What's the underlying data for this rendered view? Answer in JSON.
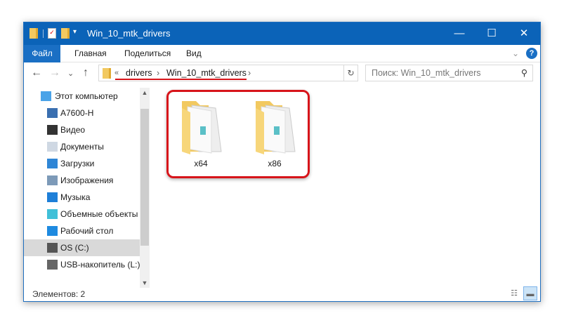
{
  "window": {
    "title": "Win_10_mtk_drivers",
    "minimize": "—",
    "maximize": "☐",
    "close": "✕"
  },
  "ribbon": {
    "tabs": [
      "Файл",
      "Главная",
      "Поделиться",
      "Вид"
    ],
    "expand": "⌄",
    "help": "?"
  },
  "nav": {
    "back": "←",
    "forward": "→",
    "recent": "⌄",
    "up": "↑"
  },
  "address": {
    "overflow": "«",
    "crumbs": [
      "drivers",
      "Win_10_mtk_drivers"
    ],
    "sep": "›",
    "refresh": "↻"
  },
  "search": {
    "placeholder": "Поиск: Win_10_mtk_drivers",
    "icon": "⚲"
  },
  "sidebar": {
    "items": [
      {
        "label": "Этот компьютер",
        "icon": "computer-icon"
      },
      {
        "label": "A7600-H",
        "icon": "phone-icon"
      },
      {
        "label": "Видео",
        "icon": "video-icon"
      },
      {
        "label": "Документы",
        "icon": "documents-icon"
      },
      {
        "label": "Загрузки",
        "icon": "downloads-icon"
      },
      {
        "label": "Изображения",
        "icon": "pictures-icon"
      },
      {
        "label": "Музыка",
        "icon": "music-icon"
      },
      {
        "label": "Объемные объекты",
        "icon": "3d-objects-icon"
      },
      {
        "label": "Рабочий стол",
        "icon": "desktop-icon"
      },
      {
        "label": "OS (C:)",
        "icon": "drive-icon",
        "selected": true
      },
      {
        "label": "USB-накопитель (L:)",
        "icon": "usb-drive-icon"
      }
    ]
  },
  "files": [
    {
      "name": "x64"
    },
    {
      "name": "x86"
    }
  ],
  "status": {
    "count": "Элементов: 2"
  },
  "colors": {
    "accent": "#0b63b8",
    "highlight": "#d7141a",
    "folder": "#f2c960"
  }
}
